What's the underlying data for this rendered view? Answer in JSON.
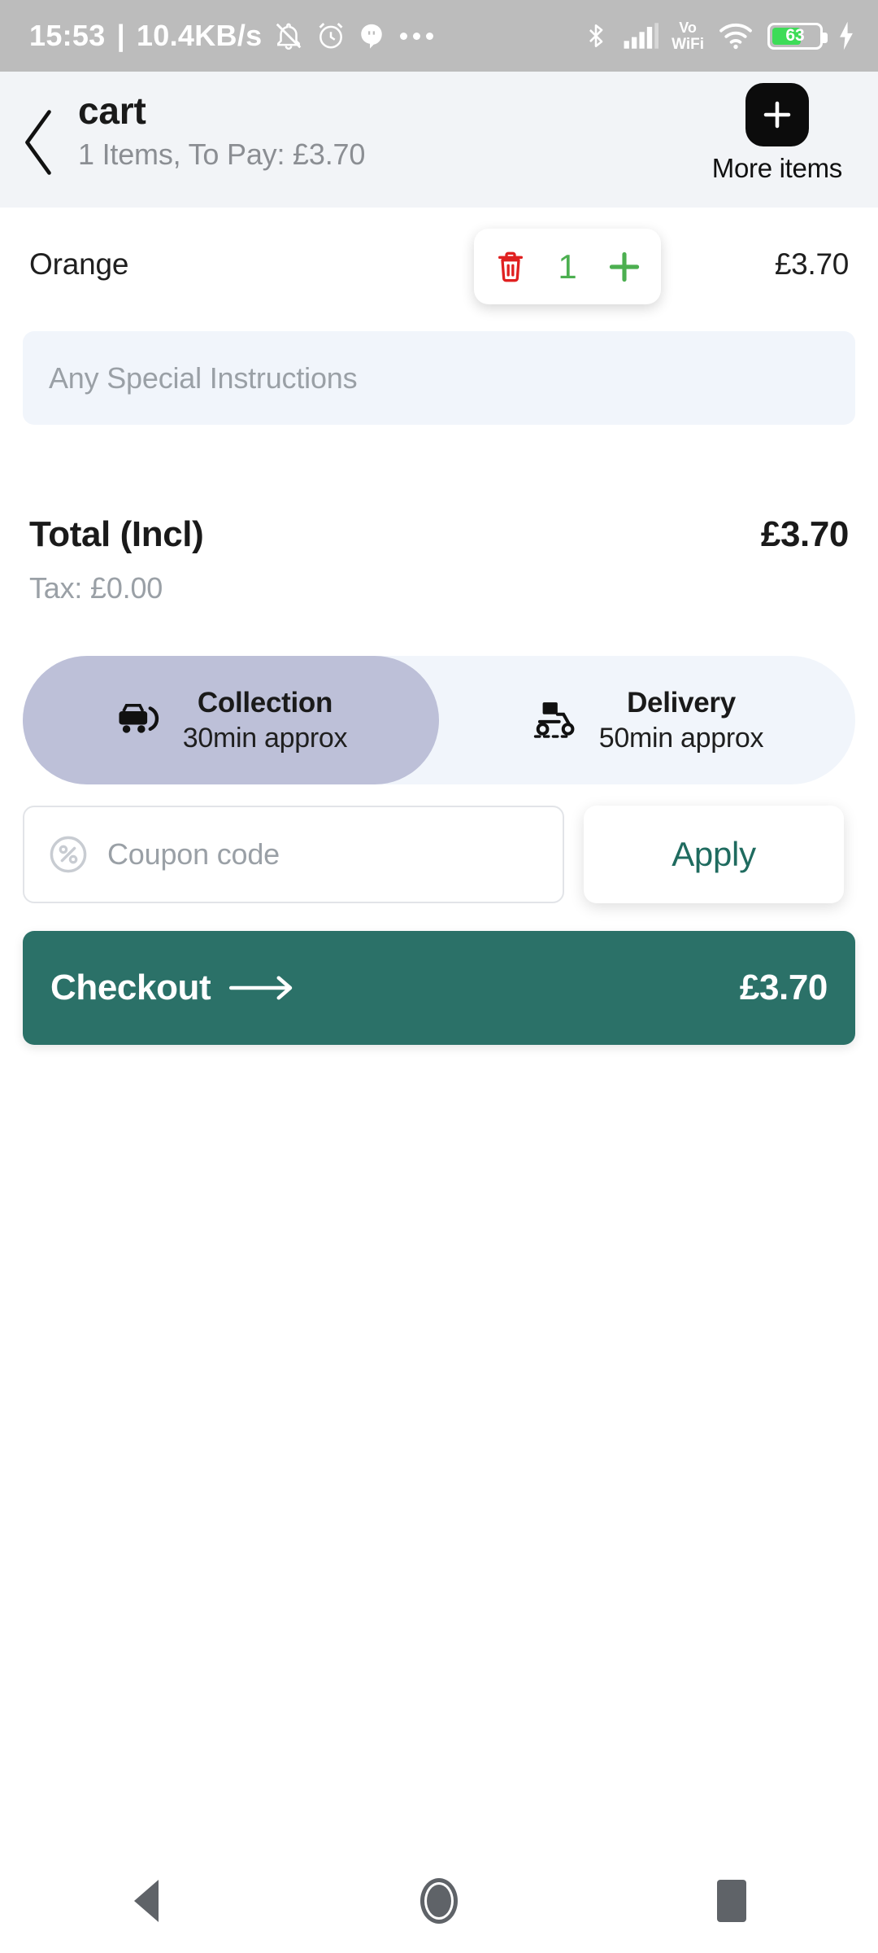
{
  "status_bar": {
    "time": "15:53",
    "separator": "|",
    "network_speed": "10.4KB/s",
    "icons_left": [
      "notification-muted-icon",
      "alarm-icon",
      "hangouts-icon",
      "more-dots-icon"
    ],
    "icons_right": [
      "bluetooth-icon",
      "signal-icon",
      "vowifi-icon",
      "wifi-icon",
      "battery-icon",
      "charging-icon"
    ],
    "vowifi_line1": "Vo",
    "vowifi_line2": "WiFi",
    "battery_level": "63",
    "battery_percent": 63,
    "battery_color": "#3ddc57",
    "background": "#bcbcbc"
  },
  "header": {
    "back_icon": "chevron-left-icon",
    "title": "cart",
    "subtitle": "1 Items, To Pay: £3.70",
    "more_items_icon": "plus-icon",
    "more_items_label": "More items",
    "background": "#f2f4f7"
  },
  "cart": {
    "items": [
      {
        "name": "Orange",
        "quantity": "1",
        "price": "£3.70",
        "delete_icon": "trash-icon",
        "increment_icon": "plus-icon",
        "qty_color": "#4caf50",
        "delete_color": "#e02020"
      }
    ],
    "instructions_placeholder": "Any Special Instructions",
    "instructions_value": ""
  },
  "totals": {
    "total_label": "Total (Incl)",
    "total_value": "£3.70",
    "tax_label": "Tax: £0.00"
  },
  "fulfilment": {
    "selected": "collection",
    "selected_color": "#bdc0d8",
    "track_color": "#f1f5fb",
    "options": [
      {
        "key": "collection",
        "icon": "car-collection-icon",
        "label": "Collection",
        "eta": "30min approx"
      },
      {
        "key": "delivery",
        "icon": "scooter-delivery-icon",
        "label": "Delivery",
        "eta": "50min approx"
      }
    ]
  },
  "coupon": {
    "icon": "percent-circle-icon",
    "placeholder": "Coupon code",
    "value": "",
    "apply_label": "Apply",
    "apply_color": "#1f6b5f"
  },
  "checkout": {
    "label": "Checkout",
    "arrow_icon": "arrow-right-icon",
    "amount": "£3.70",
    "background": "#2b7168"
  },
  "navigation_bar": {
    "back_icon": "nav-back-triangle-icon",
    "home_icon": "nav-home-circle-icon",
    "recents_icon": "nav-recents-square-icon"
  }
}
